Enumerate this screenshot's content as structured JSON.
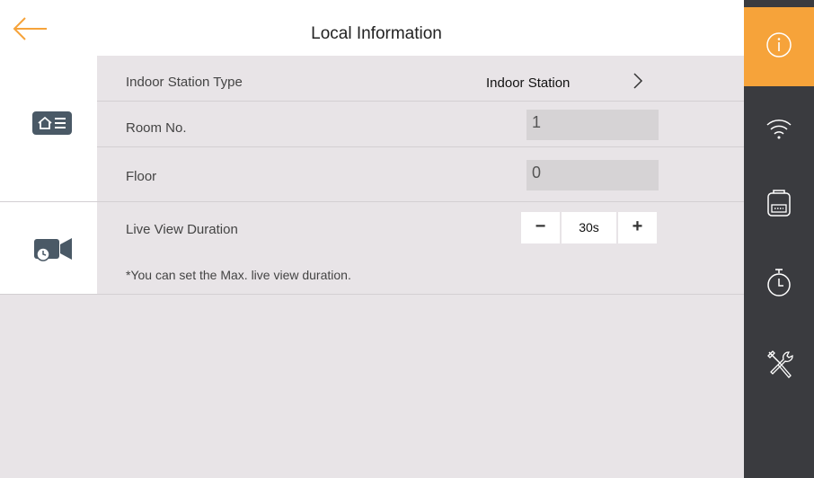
{
  "header": {
    "title": "Local Information"
  },
  "rows": {
    "station_type": {
      "label": "Indoor Station Type",
      "value": "Indoor Station"
    },
    "room_no": {
      "label": "Room No.",
      "value": "1"
    },
    "floor": {
      "label": "Floor",
      "value": "0"
    },
    "live_view": {
      "label": "Live View Duration",
      "value": "30s",
      "minus": "−",
      "plus": "+",
      "note": "*You can set the Max. live view duration."
    }
  },
  "rail": {
    "items": [
      "info-icon",
      "wifi-icon",
      "intercom-icon",
      "timer-icon",
      "tools-icon"
    ],
    "active": "info-icon"
  },
  "colors": {
    "accent": "#f6a33a",
    "rail_bg": "#3a3b3f",
    "tile_icon": "#4a5966"
  }
}
